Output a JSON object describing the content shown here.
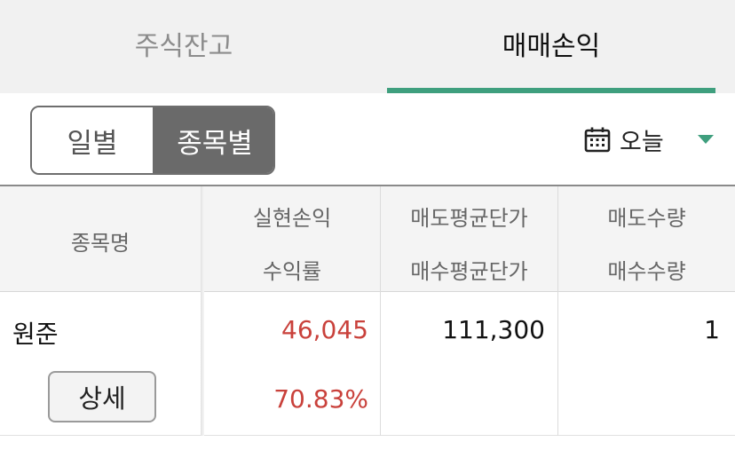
{
  "tabs": [
    {
      "label": "주식잔고",
      "active": false
    },
    {
      "label": "매매손익",
      "active": true
    }
  ],
  "accent_color": "#3f9f7e",
  "profit_color": "#c9413b",
  "view_toggle": {
    "options": [
      "일별",
      "종목별"
    ],
    "selected": "종목별"
  },
  "date_filter": {
    "icon": "calendar-icon",
    "label": "오늘"
  },
  "table": {
    "headers": {
      "col1": "종목명",
      "col2_top": "실현손익",
      "col2_bottom": "수익률",
      "col3_top": "매도평균단가",
      "col3_bottom": "매수평균단가",
      "col4_top": "매도수량",
      "col4_bottom": "매수수량"
    },
    "rows": [
      {
        "name": "원준",
        "realized_pnl": "46,045",
        "return_rate": "70.83%",
        "sell_avg_price": "111,300",
        "buy_avg_price": "",
        "sell_qty": "1",
        "buy_qty": "",
        "detail_label": "상세"
      }
    ]
  }
}
